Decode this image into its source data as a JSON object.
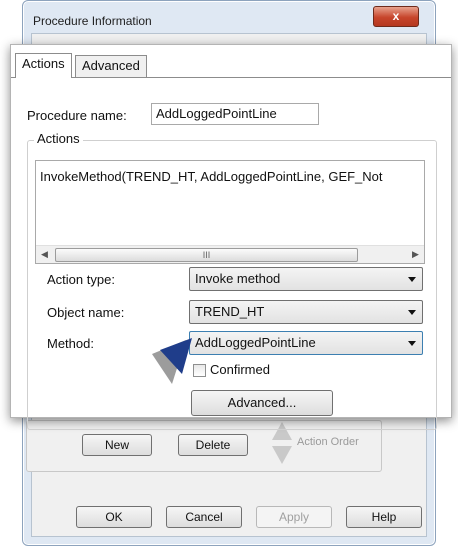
{
  "background_dialog": {
    "title": "Procedure Information",
    "close_label": "x",
    "buttons": {
      "new": "New",
      "delete": "Delete",
      "ok": "OK",
      "cancel": "Cancel",
      "apply": "Apply",
      "help": "Help"
    },
    "action_order_label": "Action Order"
  },
  "panel": {
    "tabs": [
      {
        "label": "Actions"
      },
      {
        "label": "Advanced"
      }
    ],
    "procedure_name_label": "Procedure name:",
    "procedure_name_value": "AddLoggedPointLine",
    "actions_group_label": "Actions",
    "actions_list": [
      "InvokeMethod(TREND_HT, AddLoggedPointLine, GEF_Not"
    ],
    "scroll_grip": "III",
    "action_type_label": "Action type:",
    "action_type_value": "Invoke method",
    "object_name_label": "Object name:",
    "object_name_value": "TREND_HT",
    "method_label": "Method:",
    "method_value": "AddLoggedPointLine",
    "confirmed_label": "Confirmed",
    "advanced_button": "Advanced..."
  },
  "colors": {
    "pointer": "#1f3d8a",
    "title_bar": "#dfe8f3",
    "close": "#c7452b"
  },
  "icons": {
    "close": "close-icon",
    "pointer": "arrow-pointer-icon"
  }
}
